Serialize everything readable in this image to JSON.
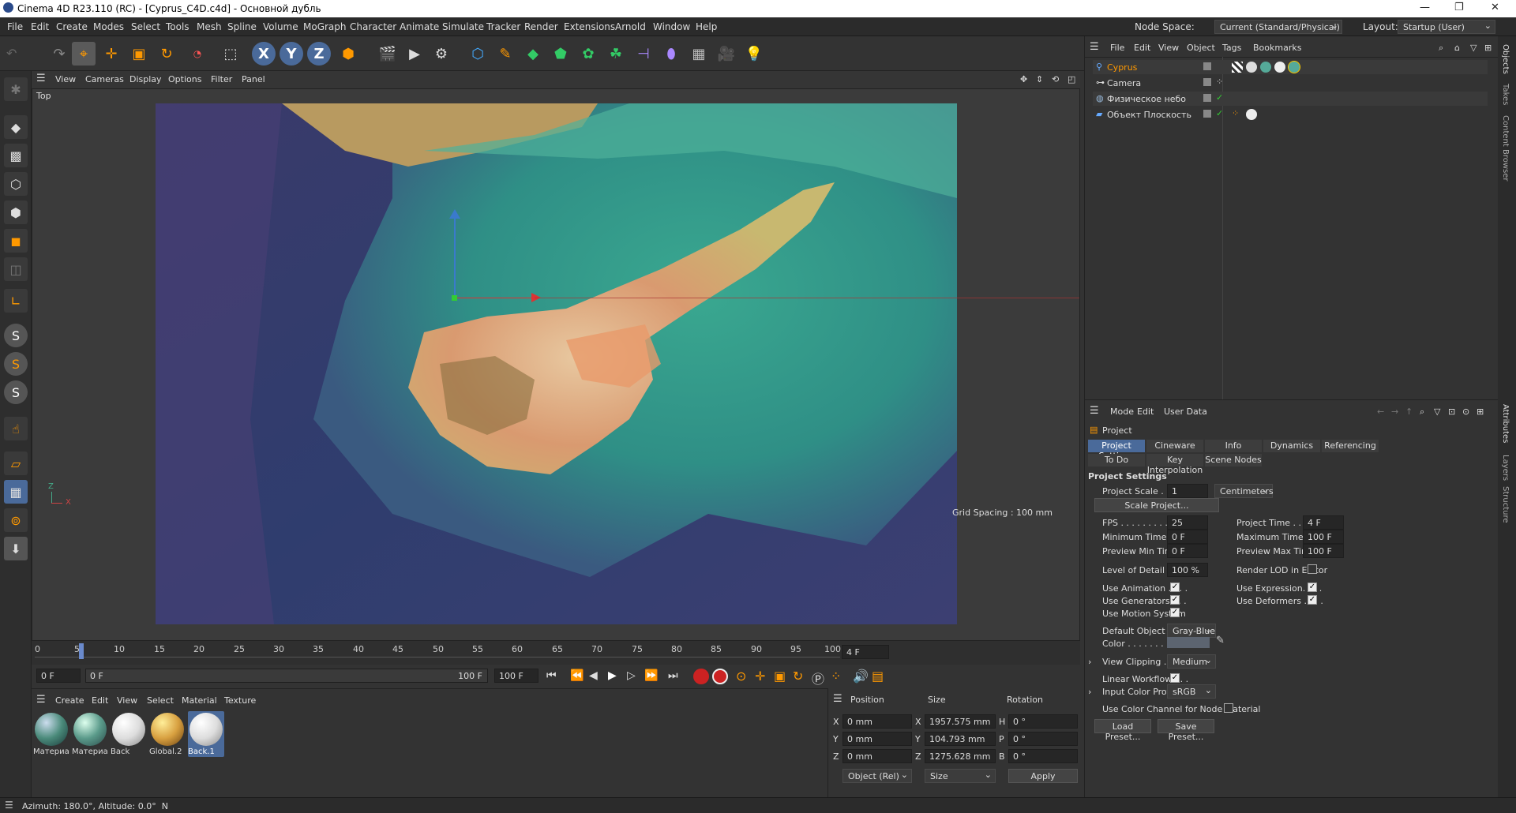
{
  "window": {
    "title": "Cinema 4D R23.110 (RC) - [Cyprus_C4D.c4d] - Основной дубль"
  },
  "menu": [
    "File",
    "Edit",
    "Create",
    "Modes",
    "Select",
    "Tools",
    "Mesh",
    "Spline",
    "Volume",
    "MoGraph",
    "Character",
    "Animate",
    "Simulate",
    "Tracker",
    "Render",
    "Extensions",
    "Arnold",
    "Window",
    "Help"
  ],
  "node_space": {
    "label": "Node Space:",
    "value": "Current (Standard/Physical)"
  },
  "layout": {
    "label": "Layout:",
    "value": "Startup (User)"
  },
  "viewport": {
    "menu": [
      "View",
      "Cameras",
      "Display",
      "Options",
      "Filter",
      "Panel"
    ],
    "name": "Top",
    "grid_spacing": "Grid Spacing : 100 mm",
    "axis_z": "Z",
    "axis_x": "X"
  },
  "timeline": {
    "ticks": [
      "0",
      "5",
      "10",
      "15",
      "20",
      "25",
      "30",
      "35",
      "40",
      "45",
      "50",
      "55",
      "60",
      "65",
      "70",
      "75",
      "80",
      "85",
      "90",
      "95",
      "100"
    ],
    "current": "4 F",
    "start_field": "0 F",
    "range_start": "0 F",
    "range_end": "100 F",
    "end_field": "100 F"
  },
  "materials": {
    "menu": [
      "Create",
      "Edit",
      "View",
      "Select",
      "Material",
      "Texture"
    ],
    "items": [
      {
        "name": "Материа",
        "color": "#5a8a7a"
      },
      {
        "name": "Материа",
        "color": "#6a9a8a"
      },
      {
        "name": "Back",
        "color": "#e8e8e8"
      },
      {
        "name": "Global.2",
        "color": "#d8a040"
      },
      {
        "name": "Back.1",
        "color": "#e0e0e0"
      }
    ]
  },
  "coords": {
    "headers": [
      "Position",
      "Size",
      "Rotation"
    ],
    "rows": [
      {
        "axis": "X",
        "pos": "0 mm",
        "saxis": "X",
        "size": "1957.575 mm",
        "raxis": "H",
        "rot": "0 °"
      },
      {
        "axis": "Y",
        "pos": "0 mm",
        "saxis": "Y",
        "size": "104.793 mm",
        "raxis": "P",
        "rot": "0 °"
      },
      {
        "axis": "Z",
        "pos": "0 mm",
        "saxis": "Z",
        "size": "1275.628 mm",
        "raxis": "B",
        "rot": "0 °"
      }
    ],
    "mode": "Object (Rel)",
    "size_mode": "Size",
    "apply": "Apply"
  },
  "objects": {
    "menu": [
      "File",
      "Edit",
      "View",
      "Object",
      "Tags",
      "Bookmarks"
    ],
    "items": [
      "Cyprus",
      "Camera",
      "Физическое небо",
      "Объект Плоскость"
    ]
  },
  "attributes": {
    "menu": [
      "Mode",
      "Edit",
      "User Data"
    ],
    "title": "Project",
    "tabs_row1": [
      "Project Settings",
      "Cineware",
      "Info",
      "Dynamics",
      "Referencing"
    ],
    "tabs_row2": [
      "To Do",
      "Key Interpolation",
      "Scene Nodes"
    ],
    "section": "Project Settings",
    "project_scale_label": "Project Scale . . . . .",
    "project_scale": "1",
    "project_scale_unit": "Centimeters",
    "scale_btn": "Scale Project...",
    "fps_label": "FPS . . . . . . . . . . . .",
    "fps": "25",
    "project_time_label": "Project Time . . . . .",
    "project_time": "4 F",
    "min_time_label": "Minimum Time . . .",
    "min_time": "0 F",
    "max_time_label": "Maximum Time . . .",
    "max_time": "100 F",
    "prev_min_label": "Preview Min Time . .",
    "prev_min": "0 F",
    "prev_max_label": "Preview Max Time .",
    "prev_max": "100 F",
    "lod_label": "Level of Detail . . .",
    "lod": "100 %",
    "render_lod_label": "Render LOD in Editor",
    "use_anim": "Use Animation . . . .",
    "use_expr": "Use Expression. . . .",
    "use_gen": "Use Generators . . .",
    "use_def": "Use Deformers . . . .",
    "use_motion": "Use Motion System",
    "default_color_label": "Default Object Color",
    "default_color": "Gray-Blue",
    "color_label": "Color . . . . . . . . . . .",
    "view_clip_label": "View Clipping . . . . .",
    "view_clip": "Medium",
    "linear_label": "Linear Workflow . . .",
    "profile_label": "Input Color Profile . .",
    "profile": "sRGB",
    "node_mat_label": "Use Color Channel for Node Material",
    "load_preset": "Load Preset...",
    "save_preset": "Save Preset..."
  },
  "side_tabs": [
    "Objects",
    "Takes",
    "Content Browser",
    "Attributes",
    "Layers",
    "Structure"
  ],
  "status": "Azimuth: 180.0°, Altitude: 0.0°  N"
}
